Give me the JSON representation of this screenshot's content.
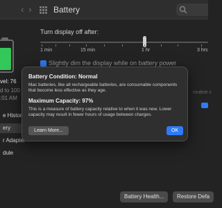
{
  "window": {
    "title": "Battery",
    "back_glyph": "‹",
    "forward_glyph": "›"
  },
  "sidebar": {
    "level_label": "vel: 76",
    "charged_line": "d to 100",
    "time_line": ":01 AM",
    "items": [
      {
        "label": "e History"
      },
      {
        "label": "ery"
      },
      {
        "label": "r Adapter"
      },
      {
        "label": "dule"
      }
    ]
  },
  "display": {
    "turn_off_label": "Turn display off after:",
    "tick_labels": [
      "1 min",
      "15 min",
      "1 hr",
      "3 hrs"
    ],
    "dim_label": "Slightly dim the display while on battery power",
    "routine_fragment": "routine c",
    "dim_value": 0.85
  },
  "dialog": {
    "condition_title": "Battery Condition: Normal",
    "condition_body": "Mac batteries, like all rechargeable batteries, are consumable components that become less effective as they age.",
    "capacity_title": "Maximum Capacity: 97%",
    "capacity_body": "This is a measure of battery capacity relative to when it was new. Lower capacity may result in fewer hours of usage between charges.",
    "learn_more_label": "Learn More...",
    "ok_label": "OK"
  },
  "footer": {
    "battery_health_label": "Battery Health...",
    "restore_label": "Restore Defa"
  },
  "colors": {
    "accent": "#2f7bf6",
    "battery_fill": "#34c759",
    "dialog_bg": "#2f2f2f"
  },
  "icons": {
    "grid": "grid-icon",
    "search": "search-icon",
    "battery": "battery-icon"
  }
}
